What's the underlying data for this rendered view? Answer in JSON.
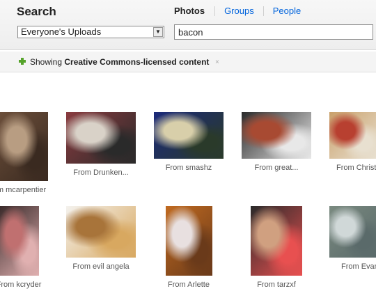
{
  "search": {
    "title": "Search",
    "tabs": [
      "Photos",
      "Groups",
      "People"
    ],
    "scope_selected": "Everyone's Uploads",
    "query": "bacon"
  },
  "notice": {
    "prefix": "Showing ",
    "strong": "Creative Commons-licensed content",
    "close": "×"
  },
  "photos": [
    {
      "caption": "m mcarpentier",
      "colors": [
        "#6b4e3a",
        "#b89d82",
        "#3a2a20"
      ]
    },
    {
      "caption": "From Drunken...",
      "colors": [
        "#8a3b3f",
        "#d9d2c8",
        "#2a2a2a"
      ]
    },
    {
      "caption": "From smashz",
      "colors": [
        "#1b2a7a",
        "#d8cfaa",
        "#2a3a2a"
      ]
    },
    {
      "caption": "From great...",
      "colors": [
        "#2a2a2a",
        "#a84a32",
        "#e8e8e8"
      ]
    },
    {
      "caption": "From Christ",
      "colors": [
        "#c9a06a",
        "#b84030",
        "#e8e0d0"
      ]
    },
    {
      "caption": "From kcryder",
      "colors": [
        "#3a2a2a",
        "#c07070",
        "#e0b0b0"
      ]
    },
    {
      "caption": "From evil angela",
      "colors": [
        "#f4f2ee",
        "#a8743a",
        "#d8a860"
      ]
    },
    {
      "caption": "From Arlette",
      "colors": [
        "#c06a20",
        "#e8e0e0",
        "#6a3a1a"
      ]
    },
    {
      "caption": "From tarzxf",
      "colors": [
        "#2a2a2a",
        "#d0a080",
        "#e85050"
      ]
    },
    {
      "caption": "From Evan",
      "colors": [
        "#7a8a80",
        "#d0d8d8",
        "#5a6a6a"
      ]
    }
  ]
}
